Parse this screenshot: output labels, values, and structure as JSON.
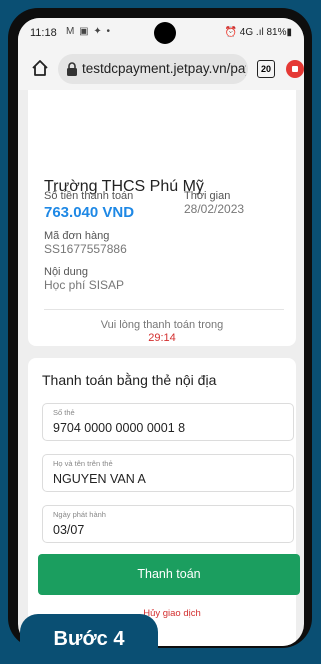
{
  "status_bar": {
    "time": "11:18",
    "notif_icons": "M ▣ ✦ •",
    "right_text": "⏰ 4G .ıl 81%▮"
  },
  "browser": {
    "url": "testdcpayment.jetpay.vn/pay",
    "tab_count": "20"
  },
  "order": {
    "merchant_name": "Trường THCS Phú Mỹ",
    "amount_label": "Số tiền thanh toán",
    "amount": "763.040 VND",
    "time_label": "Thời gian",
    "time": "28/02/2023",
    "order_id_label": "Mã đơn hàng",
    "order_id": "SS1677557886",
    "content_label": "Nội dung",
    "content": "Học phí SISAP",
    "notice": "Vui lòng thanh toán trong",
    "countdown": "29:14"
  },
  "payment": {
    "title": "Thanh toán bằng thẻ nội địa",
    "card_number_label": "Số thẻ",
    "card_number": "9704 0000 0000 0001 8",
    "holder_label": "Họ và tên trên thẻ",
    "holder": "NGUYEN VAN A",
    "issue_date_label": "Ngày phát hành",
    "issue_date": "03/07",
    "pay_button": "Thanh toán",
    "cancel_link": "Hủy giao dịch"
  },
  "step_badge": "Bước 4",
  "colors": {
    "accent_amount": "#1e88e5",
    "pay_button": "#1b9e5f",
    "warning": "#d32f2f",
    "background": "#0a4f73"
  }
}
